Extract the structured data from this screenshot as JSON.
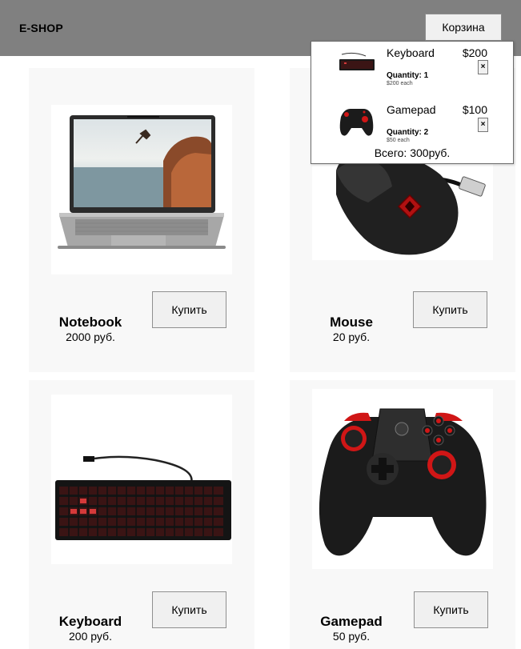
{
  "header": {
    "logo": "E-SHOP",
    "cart_button": "Корзина",
    "background": "#808080"
  },
  "products": [
    {
      "name": "Notebook",
      "price": "2000 руб.",
      "buy_label": "Купить",
      "image": "notebook-image"
    },
    {
      "name": "Mouse",
      "price": "20 руб.",
      "buy_label": "Купить",
      "image": "mouse-image"
    },
    {
      "name": "Keyboard",
      "price": "200 руб.",
      "buy_label": "Купить",
      "image": "keyboard-image"
    },
    {
      "name": "Gamepad",
      "price": "50 руб.",
      "buy_label": "Купить",
      "image": "gamepad-image"
    }
  ],
  "cart": {
    "items": [
      {
        "name": "Keyboard",
        "price": "$200",
        "quantity": "Quantity: 1",
        "each": "$200 each",
        "remove": "×"
      },
      {
        "name": "Gamepad",
        "price": "$100",
        "quantity": "Quantity: 2",
        "each": "$50 each",
        "remove": "×"
      }
    ],
    "total": "Всего: 300руб."
  }
}
